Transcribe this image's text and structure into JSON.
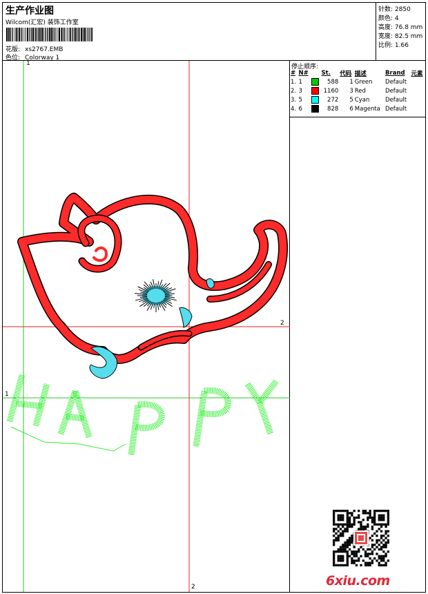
{
  "header": {
    "title": "生产作业图",
    "company": "Wilcom(汇宏) 装饰工作室",
    "design_label": "花版:",
    "design_value": "xs2767.EMB",
    "colorway_label": "色位:",
    "colorway_value": "Colorway 1"
  },
  "stats": {
    "stitches": "针数: 2850",
    "colors": "颜色: 4",
    "height": "高度: 76.8 mm",
    "width": "宽度: 82.5 mm",
    "scale": "比例: 1.66"
  },
  "stop_sequence": {
    "title": "停止顺序:",
    "headers": [
      "#",
      "N#",
      "St.",
      "代码",
      "描述",
      "Brand",
      "元素"
    ],
    "rows": [
      {
        "idx": "1.",
        "n": "1",
        "st": "588",
        "code": "1",
        "desc": "Green",
        "brand": "Default",
        "color": "#00cc00"
      },
      {
        "idx": "2.",
        "n": "3",
        "st": "1160",
        "code": "3",
        "desc": "Red",
        "brand": "Default",
        "color": "#ff0000"
      },
      {
        "idx": "3.",
        "n": "5",
        "st": "272",
        "code": "5",
        "desc": "Cyan",
        "brand": "Default",
        "color": "#00ffff"
      },
      {
        "idx": "4.",
        "n": "6",
        "st": "828",
        "code": "6",
        "desc": "Magenta",
        "brand": "Default",
        "color": "#000000"
      }
    ]
  },
  "guides": {
    "v1_label": "1",
    "h1_label": "1",
    "h2_label": "2",
    "v2_label": "2"
  },
  "design": {
    "text": "HAPPY",
    "text_color": "#33ee33",
    "red_color": "#ff2a2a",
    "cyan_color": "#55ddee",
    "black_color": "#000000"
  },
  "watermark": {
    "site": "6xiu.com"
  }
}
